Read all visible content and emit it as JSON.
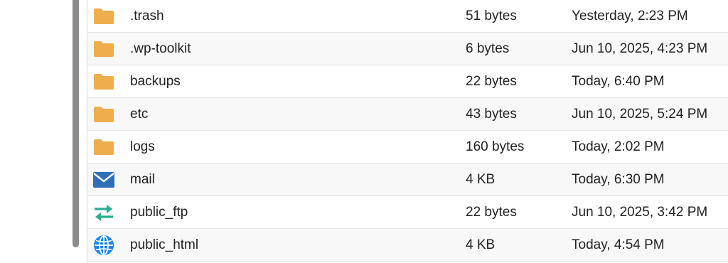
{
  "files": [
    {
      "name": ".trash",
      "size": "51 bytes",
      "modified": "Yesterday, 2:23 PM",
      "icon": "folder-icon"
    },
    {
      "name": ".wp-toolkit",
      "size": "6 bytes",
      "modified": "Jun 10, 2025, 4:23 PM",
      "icon": "folder-icon"
    },
    {
      "name": "backups",
      "size": "22 bytes",
      "modified": "Today, 6:40 PM",
      "icon": "folder-icon"
    },
    {
      "name": "etc",
      "size": "43 bytes",
      "modified": "Jun 10, 2025, 5:24 PM",
      "icon": "folder-icon"
    },
    {
      "name": "logs",
      "size": "160 bytes",
      "modified": "Today, 2:02 PM",
      "icon": "folder-icon"
    },
    {
      "name": "mail",
      "size": "4 KB",
      "modified": "Today, 6:30 PM",
      "icon": "mail-icon"
    },
    {
      "name": "public_ftp",
      "size": "22 bytes",
      "modified": "Jun 10, 2025, 3:42 PM",
      "icon": "transfer-arrows-icon"
    },
    {
      "name": "public_html",
      "size": "4 KB",
      "modified": "Today, 4:54 PM",
      "icon": "globe-icon"
    }
  ],
  "colors": {
    "folder": "#f0ad4e",
    "mail": "#2f6fb5",
    "transfer": "#27ae8f",
    "globe": "#1b87e6"
  }
}
